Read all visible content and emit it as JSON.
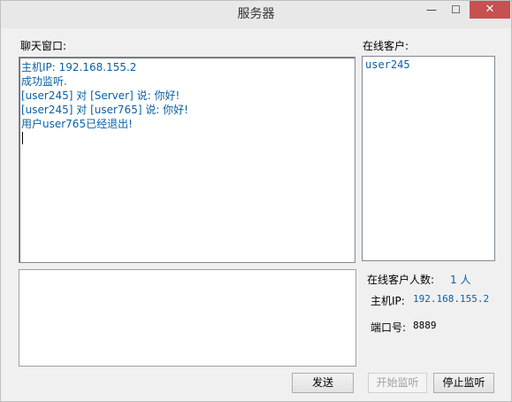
{
  "window": {
    "title": "服务器",
    "minimize_glyph": "—",
    "maximize_glyph": "☐",
    "close_glyph": "✕"
  },
  "chat": {
    "label": "聊天窗口:",
    "lines": [
      "主机IP: 192.168.155.2",
      "成功监听.",
      "[user245] 对 [Server] 说: 你好!",
      "[user245] 对 [user765] 说: 你好!",
      "用户user765已经退出!"
    ]
  },
  "clients": {
    "label": "在线客户:",
    "items": [
      "user245"
    ]
  },
  "info": {
    "count_label": "在线客户人数:",
    "count_value": "1 人",
    "ip_label": "主机IP:",
    "ip_value": "192.168.155.2",
    "port_label": "端口号:",
    "port_value": "8889"
  },
  "buttons": {
    "send": "发送",
    "start": "开始监听",
    "stop": "停止监听"
  }
}
